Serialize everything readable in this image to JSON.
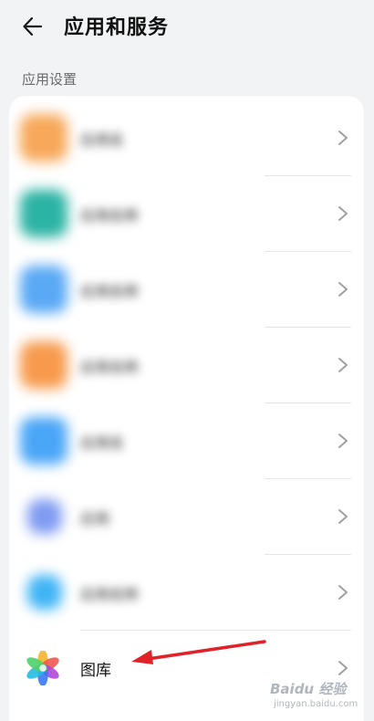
{
  "header": {
    "title": "应用和服务",
    "back_icon": "arrow-left-icon"
  },
  "section": {
    "label": "应用设置"
  },
  "apps": [
    {
      "label": "应用名",
      "color": "#f7a85a",
      "blurred": true
    },
    {
      "label": "应用名称",
      "color": "#2bb3a3",
      "blurred": true
    },
    {
      "label": "应用名称",
      "color": "#5aa9f5",
      "blurred": true
    },
    {
      "label": "应用名称",
      "color": "#f79a4d",
      "blurred": true
    },
    {
      "label": "应用名",
      "color": "#4aa6f7",
      "blurred": true
    },
    {
      "label": "应用",
      "color": "#7f9bf2",
      "blurred": true
    },
    {
      "label": "应用名称",
      "color": "#3fb4f5",
      "blurred": true
    },
    {
      "label": "图库",
      "icon": "gallery-pinwheel-icon",
      "blurred": false
    }
  ],
  "chevron_icon": "chevron-right-icon",
  "annotation": {
    "icon": "red-arrow-annotation",
    "color": "#e0222a"
  },
  "watermark": {
    "text": "Baidu 经验",
    "sub": "jingyan.baidu.com"
  }
}
